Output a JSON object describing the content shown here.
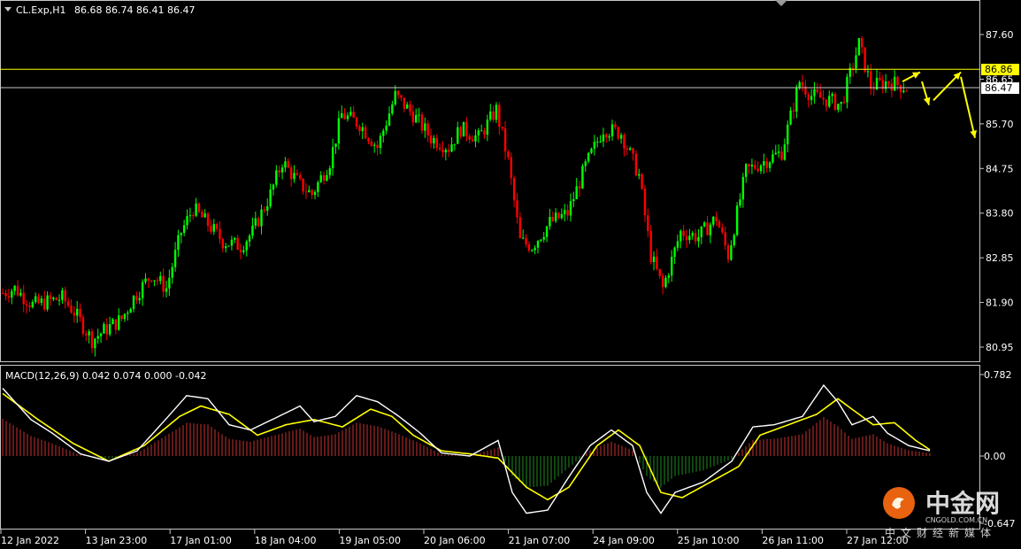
{
  "header": {
    "symbol": "CL.Exp,H1",
    "ohlc": "86.68 86.74 86.41 86.47"
  },
  "macd": {
    "label": "MACD(12,26,9) 0.042 0.074 0.000 -0.042"
  },
  "price_axis": {
    "ticks": [
      "87.60",
      "86.65",
      "85.70",
      "84.75",
      "83.80",
      "82.85",
      "81.90",
      "80.95"
    ],
    "tick_values": [
      87.6,
      86.65,
      85.7,
      84.75,
      83.8,
      82.85,
      81.9,
      80.95
    ],
    "tag_yellow": "86.86",
    "tag_white": "86.47"
  },
  "macd_axis": {
    "ticks": [
      "0.782",
      "0.00",
      "-0.647"
    ],
    "tick_values": [
      0.782,
      0.0,
      -0.647
    ]
  },
  "time_axis": {
    "labels": [
      "12 Jan 2022",
      "13 Jan 23:00",
      "17 Jan 01:00",
      "18 Jan 04:00",
      "19 Jan 05:00",
      "20 Jan 06:00",
      "21 Jan 07:00",
      "24 Jan 09:00",
      "25 Jan 10:00",
      "26 Jan 11:00",
      "27 Jan 12:00"
    ]
  },
  "watermark": {
    "brand_cn": "中金网",
    "brand_en": "CNGOLD.COM.CN",
    "slogan_cn": "中文财经新媒体"
  },
  "colors": {
    "background": "#000000",
    "bull": "#00ff00",
    "bear": "#ff0000",
    "histogram_pos": "#c83232",
    "histogram_neg": "#1e8c1e",
    "signal": "#ffff00",
    "macd_line": "#ffffff",
    "level_line": "#ffff00",
    "axis": "#c8c8c8"
  },
  "chart_data": {
    "type": "candlestick",
    "symbol": "CL.Exp",
    "timeframe": "H1",
    "ylim": [
      80.6,
      88.0
    ],
    "levels": [
      86.86,
      86.47
    ],
    "close_path": [
      [
        0,
        82.1
      ],
      [
        4,
        82.2
      ],
      [
        10,
        81.85
      ],
      [
        14,
        81.9
      ],
      [
        20,
        82.0
      ],
      [
        24,
        81.7
      ],
      [
        30,
        81.1
      ],
      [
        34,
        81.3
      ],
      [
        40,
        81.55
      ],
      [
        44,
        82.0
      ],
      [
        50,
        82.5
      ],
      [
        55,
        82.2
      ],
      [
        60,
        83.4
      ],
      [
        64,
        83.9
      ],
      [
        70,
        83.5
      ],
      [
        74,
        83.2
      ],
      [
        80,
        83.1
      ],
      [
        84,
        83.4
      ],
      [
        90,
        84.2
      ],
      [
        94,
        84.9
      ],
      [
        100,
        84.4
      ],
      [
        104,
        84.2
      ],
      [
        110,
        84.9
      ],
      [
        114,
        85.9
      ],
      [
        120,
        85.7
      ],
      [
        126,
        85.2
      ],
      [
        132,
        86.3
      ],
      [
        138,
        85.9
      ],
      [
        144,
        85.4
      ],
      [
        150,
        85.2
      ],
      [
        154,
        85.6
      ],
      [
        160,
        85.4
      ],
      [
        166,
        86.0
      ],
      [
        170,
        84.9
      ],
      [
        174,
        83.2
      ],
      [
        178,
        83.1
      ],
      [
        184,
        83.6
      ],
      [
        190,
        83.8
      ],
      [
        196,
        84.8
      ],
      [
        202,
        85.6
      ],
      [
        208,
        85.5
      ],
      [
        214,
        84.6
      ],
      [
        218,
        82.9
      ],
      [
        222,
        82.2
      ],
      [
        228,
        83.4
      ],
      [
        234,
        83.3
      ],
      [
        240,
        83.7
      ],
      [
        244,
        82.9
      ],
      [
        250,
        84.7
      ],
      [
        256,
        84.9
      ],
      [
        262,
        85.1
      ],
      [
        268,
        86.6
      ],
      [
        272,
        86.3
      ],
      [
        278,
        86.2
      ],
      [
        282,
        86.1
      ],
      [
        288,
        87.4
      ],
      [
        292,
        86.5
      ],
      [
        298,
        86.6
      ],
      [
        304,
        86.47
      ]
    ],
    "macd_path": [
      [
        0,
        0.65
      ],
      [
        8,
        0.35
      ],
      [
        14,
        0.22
      ],
      [
        22,
        0.02
      ],
      [
        30,
        -0.05
      ],
      [
        38,
        0.05
      ],
      [
        46,
        0.35
      ],
      [
        52,
        0.58
      ],
      [
        58,
        0.55
      ],
      [
        64,
        0.3
      ],
      [
        70,
        0.25
      ],
      [
        78,
        0.38
      ],
      [
        84,
        0.48
      ],
      [
        88,
        0.33
      ],
      [
        94,
        0.38
      ],
      [
        100,
        0.58
      ],
      [
        106,
        0.52
      ],
      [
        112,
        0.38
      ],
      [
        118,
        0.22
      ],
      [
        124,
        0.03
      ],
      [
        132,
        0.0
      ],
      [
        140,
        0.15
      ],
      [
        144,
        -0.35
      ],
      [
        148,
        -0.55
      ],
      [
        154,
        -0.52
      ],
      [
        160,
        -0.2
      ],
      [
        166,
        0.1
      ],
      [
        172,
        0.25
      ],
      [
        178,
        0.1
      ],
      [
        182,
        -0.35
      ],
      [
        186,
        -0.55
      ],
      [
        190,
        -0.35
      ],
      [
        198,
        -0.25
      ],
      [
        206,
        -0.05
      ],
      [
        212,
        0.28
      ],
      [
        218,
        0.3
      ],
      [
        226,
        0.38
      ],
      [
        232,
        0.68
      ],
      [
        236,
        0.52
      ],
      [
        240,
        0.3
      ],
      [
        246,
        0.38
      ],
      [
        250,
        0.22
      ],
      [
        256,
        0.1
      ],
      [
        262,
        0.05
      ]
    ],
    "signal_path": [
      [
        0,
        0.6
      ],
      [
        10,
        0.35
      ],
      [
        20,
        0.12
      ],
      [
        30,
        -0.05
      ],
      [
        40,
        0.1
      ],
      [
        50,
        0.38
      ],
      [
        56,
        0.48
      ],
      [
        64,
        0.4
      ],
      [
        72,
        0.2
      ],
      [
        80,
        0.3
      ],
      [
        88,
        0.35
      ],
      [
        96,
        0.28
      ],
      [
        104,
        0.45
      ],
      [
        110,
        0.38
      ],
      [
        116,
        0.2
      ],
      [
        124,
        0.05
      ],
      [
        132,
        0.02
      ],
      [
        140,
        -0.02
      ],
      [
        148,
        -0.3
      ],
      [
        154,
        -0.42
      ],
      [
        160,
        -0.3
      ],
      [
        168,
        0.1
      ],
      [
        174,
        0.25
      ],
      [
        180,
        0.1
      ],
      [
        186,
        -0.35
      ],
      [
        192,
        -0.4
      ],
      [
        200,
        -0.25
      ],
      [
        208,
        -0.1
      ],
      [
        214,
        0.2
      ],
      [
        222,
        0.3
      ],
      [
        230,
        0.4
      ],
      [
        236,
        0.55
      ],
      [
        240,
        0.45
      ],
      [
        246,
        0.3
      ],
      [
        252,
        0.32
      ],
      [
        258,
        0.15
      ],
      [
        262,
        0.06
      ]
    ],
    "forecast_arrows": [
      [
        [
          1020,
          86.6
        ],
        [
          1040,
          86.8
        ]
      ],
      [
        [
          1042,
          86.6
        ],
        [
          1050,
          86.1
        ]
      ],
      [
        [
          1055,
          86.2
        ],
        [
          1086,
          86.8
        ]
      ],
      [
        [
          1086,
          86.7
        ],
        [
          1102,
          85.4
        ]
      ]
    ]
  }
}
